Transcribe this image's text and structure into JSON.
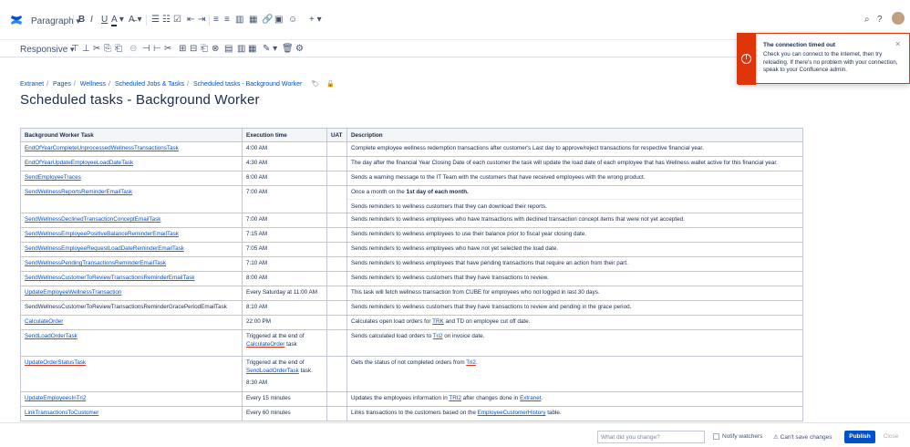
{
  "toolbar": {
    "style_select": "Paragraph",
    "alignment_select": "Responsive"
  },
  "breadcrumb": [
    "Extranet",
    "Pages",
    "Wellness",
    "Scheduled Jobs & Tasks",
    "Scheduled tasks - Background Worker"
  ],
  "page_title": "Scheduled tasks - Background Worker",
  "toast": {
    "title": "The connection timed out",
    "message": "Check you can connect to the internet, then try reloading. If there's no problem with your connection, speak to your Confluence admin."
  },
  "table": {
    "headers": [
      "Background Worker Task",
      "Execution time",
      "UAT",
      "Description"
    ],
    "rows": [
      {
        "task": "EndOfYearCompleteUnprocessedWellnessTransactionsTask",
        "time": "4:00 AM",
        "desc": "Complete employee wellness redemption transactions after  customer's Last day to approve/reject transactions for respective financial year."
      },
      {
        "task": "EndOfYearUpdateEmployeeLoadDateTask",
        "time": "4:30 AM",
        "desc": "The day after the financial Year Closing Date of each customer the task will update the load date of each employee that has Wellness wallet active for this financial year."
      },
      {
        "task": "SendEmployeeTraces",
        "time": "6:00 AM",
        "desc": "Sends a warning message to the IT Team with the customers that have received employees with the wrong product."
      },
      {
        "task": "SendWellnessReportsReminderEmailTask",
        "time": "7:00 AM",
        "desc": "Once a month on the 1st day of each month.",
        "desc2": "Sends reminders to wellness customers that they can download their reports."
      },
      {
        "task": "SendWellnessDeclinedTransactionConceptEmailTask",
        "time": "7:00 AM",
        "desc": "Sends reminders to wellness employees who have transactions with declined transaction concept items that were not yet accepted."
      },
      {
        "task": "SendWellnessEmployeePositiveBalanceReminderEmailTask",
        "time": "7:15 AM",
        "desc": "Sends reminders to wellness employees to use their balance prior to fiscal year closing date."
      },
      {
        "task": "SendWellnessEmployeeRequestLoadDateReminderEmailTask",
        "time": "7:05 AM",
        "desc": "Sends reminders to wellness employees who have not yet selected the load date."
      },
      {
        "task": "SendWellnessPendingTransactionsReminderEmailTask",
        "time": "7:10 AM",
        "desc": "Sends reminders to wellness employees that have pending transactions that require an action from their part."
      },
      {
        "task": "SendWellnessCustomerToReviewTransactionsReminderEmailTask",
        "time": "8:00 AM",
        "desc": "Sends reminders to wellness customers that they have transactions to review."
      },
      {
        "task": "UpdateEmployeeWellnessTransaction",
        "time": "Every Saturday at 11:00 AM",
        "desc": "This task will fetch  wellness transaction from CUBE for employees who not logged in last 30 days."
      },
      {
        "task": "SendWellnessCustomerToReviewTransactionsReminderGracePeriodEmailTask",
        "time": "8:10 AM",
        "desc": "Sends reminders to wellness customers that they have transactions to review and pending in the grace period."
      },
      {
        "task": "CalculateOrder",
        "time": "22:00 PM",
        "desc": "Calculates open load orders for TRK and TD on employee cut off date."
      },
      {
        "task": "SendLoadOrderTask",
        "time": "Triggered at the end of CalculateOrder task",
        "desc": "Sends calculated load orders to Tri2 on invoice date."
      },
      {
        "task": "UpdateOrderStatusTask",
        "time": "Triggered at the end of SendLoadOrderTask task.",
        "time2": "8:30 AM",
        "desc": "Gets the status of not completed orders from Tri2."
      },
      {
        "task": "UpdateEmployeesInTri2",
        "time": "Every 15 minutes",
        "desc": "Updates the employees information in TRI2 after changes done in Extranet."
      },
      {
        "task": "LinkTransactionsToCustomer",
        "time": "Every 60 minutes",
        "desc": "Links transactions to the customers based on the EmployeeCustomerHistory table."
      }
    ]
  },
  "footer": {
    "comment_placeholder": "What did you change?",
    "notify_watchers": "Notify watchers",
    "cant_save": "Can't save changes",
    "publish": "Publish",
    "close": "Close"
  }
}
